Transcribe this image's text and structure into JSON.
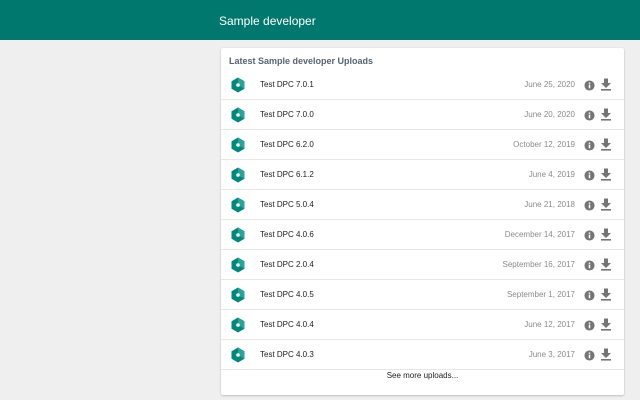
{
  "header": {
    "title": "Sample developer",
    "background": "#01786d"
  },
  "card": {
    "title": "Latest Sample developer Uploads",
    "see_more": "See more uploads..."
  },
  "icons": {
    "app": "hexagon-app-icon",
    "info": "info-icon",
    "download": "download-icon"
  },
  "colors": {
    "app_icon_dark": "#00897b",
    "app_icon_light": "#26a69a",
    "action_icon": "#757575"
  },
  "uploads": [
    {
      "name": "Test DPC 7.0.1",
      "date": "June 25, 2020"
    },
    {
      "name": "Test DPC 7.0.0",
      "date": "June 20, 2020"
    },
    {
      "name": "Test DPC 6.2.0",
      "date": "October 12, 2019"
    },
    {
      "name": "Test DPC 6.1.2",
      "date": "June 4, 2019"
    },
    {
      "name": "Test DPC 5.0.4",
      "date": "June 21, 2018"
    },
    {
      "name": "Test DPC 4.0.6",
      "date": "December 14, 2017"
    },
    {
      "name": "Test DPC 2.0.4",
      "date": "September 16, 2017"
    },
    {
      "name": "Test DPC 4.0.5",
      "date": "September 1, 2017"
    },
    {
      "name": "Test DPC 4.0.4",
      "date": "June 12, 2017"
    },
    {
      "name": "Test DPC 4.0.3",
      "date": "June 3, 2017"
    }
  ]
}
